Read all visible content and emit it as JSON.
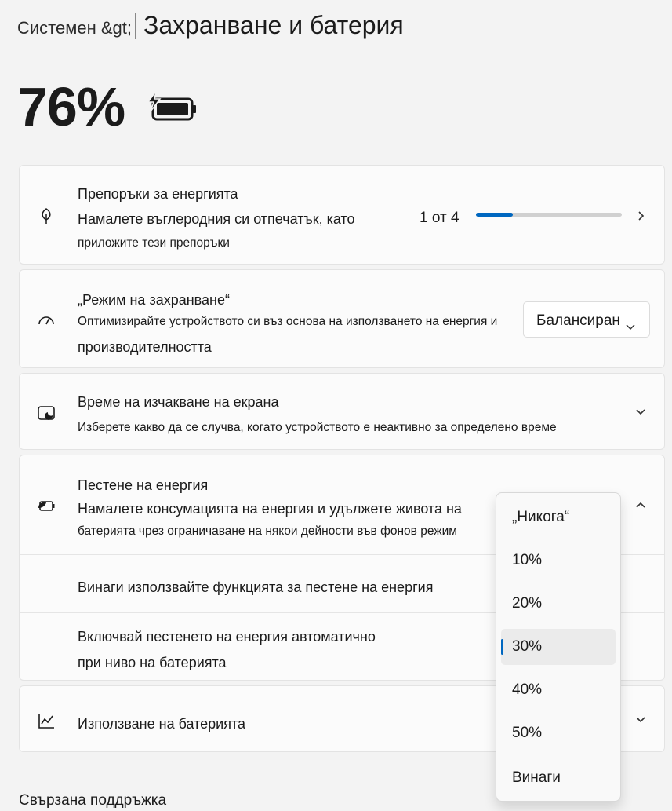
{
  "header": {
    "breadcrumb_prev": "Системен &gt;",
    "page_title": "Захранване и батерия"
  },
  "battery": {
    "percent": "76%",
    "icon": "battery-charging-icon"
  },
  "recommendations": {
    "icon": "leaf-icon",
    "title": "Препоръки за енергията",
    "desc_line1": "Намалете въглеродния си отпечатък, като",
    "desc_line2": "приложите тези препоръки",
    "count": "1 от 4",
    "progress_fraction": 0.25
  },
  "power_mode": {
    "icon": "speedometer-icon",
    "title": "„Режим на захранване“",
    "desc_line1": "Оптимизирайте устройството си въз основа на използването на енергия и",
    "desc_line2": "производителността",
    "selected_value": "Балансиран"
  },
  "screen_timeout": {
    "icon": "screen-sleep-icon",
    "title": "Време на изчакване на екрана",
    "desc": "Изберете какво да се случва, когато устройството е неактивно за определено време"
  },
  "energy_saver": {
    "icon": "battery-saver-icon",
    "title": "Пестене на енергия",
    "desc_line1": "Намалете консумацията на енергия и удължете живота на",
    "desc_line2": "батерията чрез ограничаване на някои дейности във фонов режим",
    "always_use": "Винаги използвайте функцията за пестене на енергия",
    "auto_line1": "Включвай пестенето на енергия автоматично",
    "auto_line2": "при ниво на батерията"
  },
  "battery_usage": {
    "icon": "line-chart-icon",
    "title": "Използване на батерията"
  },
  "dropdown": {
    "options": [
      "„Никога“",
      "10%",
      "20%",
      "30%",
      "40%",
      "50%",
      "Винаги"
    ],
    "selected_index": 3
  },
  "related": {
    "label": "Свързана поддръжка"
  },
  "colors": {
    "accent": "#0067c0",
    "background": "#f3f3f3",
    "card": "#fbfbfb"
  }
}
